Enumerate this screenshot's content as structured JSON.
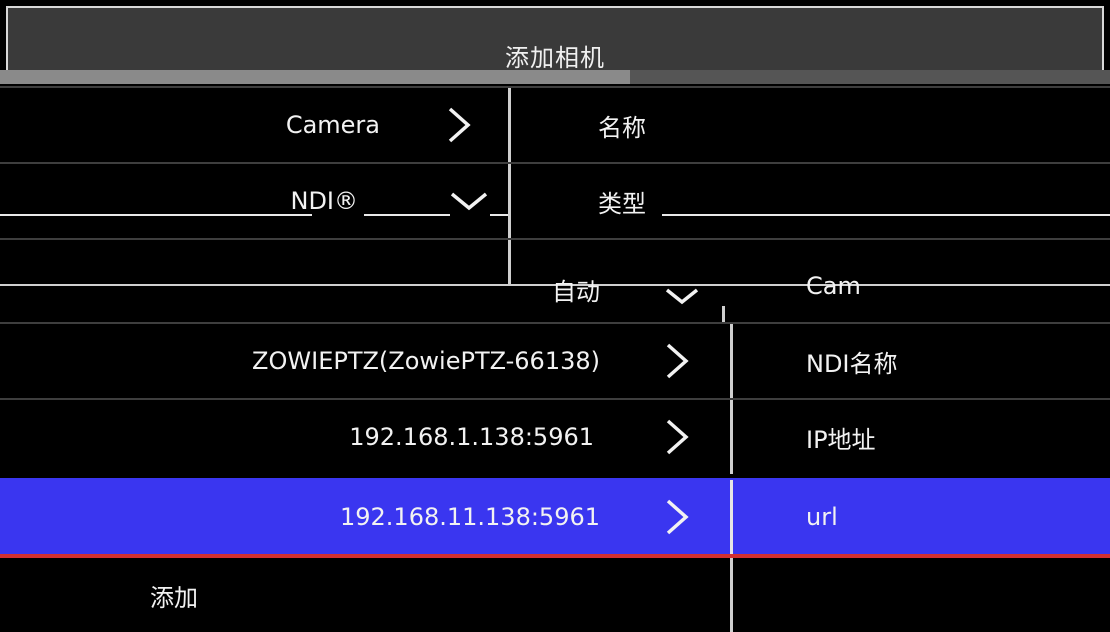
{
  "dialog": {
    "title": "添加相机"
  },
  "rows": [
    {
      "value": "Camera",
      "label": "名称"
    },
    {
      "value": "NDI®",
      "label": "类型"
    },
    {
      "value": "自动",
      "label": "Cam"
    },
    {
      "value": "ZOWIEPTZ(ZowiePTZ-66138)",
      "label": "NDI名称"
    },
    {
      "value": "192.168.1.138:5961",
      "label": "IP地址"
    },
    {
      "value": "192.168.11.138:5961",
      "label": "url"
    }
  ],
  "footer": {
    "add_label": "添加"
  },
  "colors": {
    "selected_row": "#3a36f0",
    "accent_line": "#d23030"
  },
  "icons": {
    "chevron_right": "chevron-right-icon",
    "chevron_down": "chevron-down-icon"
  }
}
